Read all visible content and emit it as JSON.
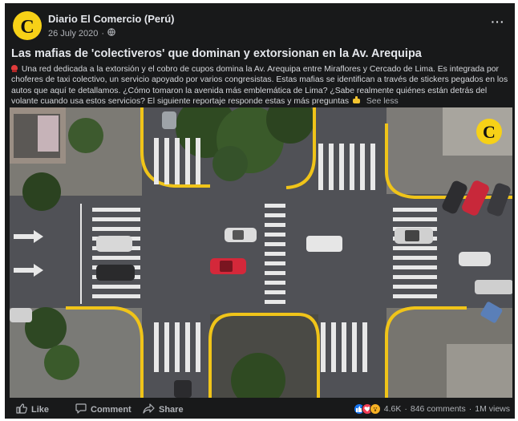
{
  "post": {
    "page_name": "Diario El Comercio (Perú)",
    "date": "26 July 2020",
    "separator": "·",
    "title": "Las mafias de 'colectiveros' que dominan y extorsionan en la Av. Arequipa",
    "body": "Una red dedicada a la extorsión y el cobro de cupos domina la Av. Arequipa entre Miraflores y Cercado de Lima. Es integrada por choferes de taxi colectivo, un servicio apoyado por varios congresistas. Estas mafias se identifican a través de stickers pegados en los autos que aquí te detallamos. ¿Cómo tomaron la avenida más emblemática de Lima? ¿Sabe realmente quiénes están detrás del volante cuando usa estos servicios? El siguiente reportaje responde estas y más preguntas",
    "see_less": "See less",
    "more_menu": "···",
    "logo_letter": "C"
  },
  "actions": {
    "like": "Like",
    "comment": "Comment",
    "share": "Share"
  },
  "stats": {
    "reactions": "4.6K",
    "comments": "846 comments",
    "dot": "·",
    "views": "1M views"
  },
  "colors": {
    "post_bg": "#18191a",
    "logo_yellow": "#f7d117",
    "curb_yellow": "#f0c419"
  },
  "icons": [
    "globe-icon",
    "more-icon",
    "pin-icon",
    "pointing-hand-icon",
    "like-icon",
    "comment-icon",
    "share-icon",
    "like-reaction-icon",
    "love-reaction-icon",
    "wow-reaction-icon"
  ]
}
